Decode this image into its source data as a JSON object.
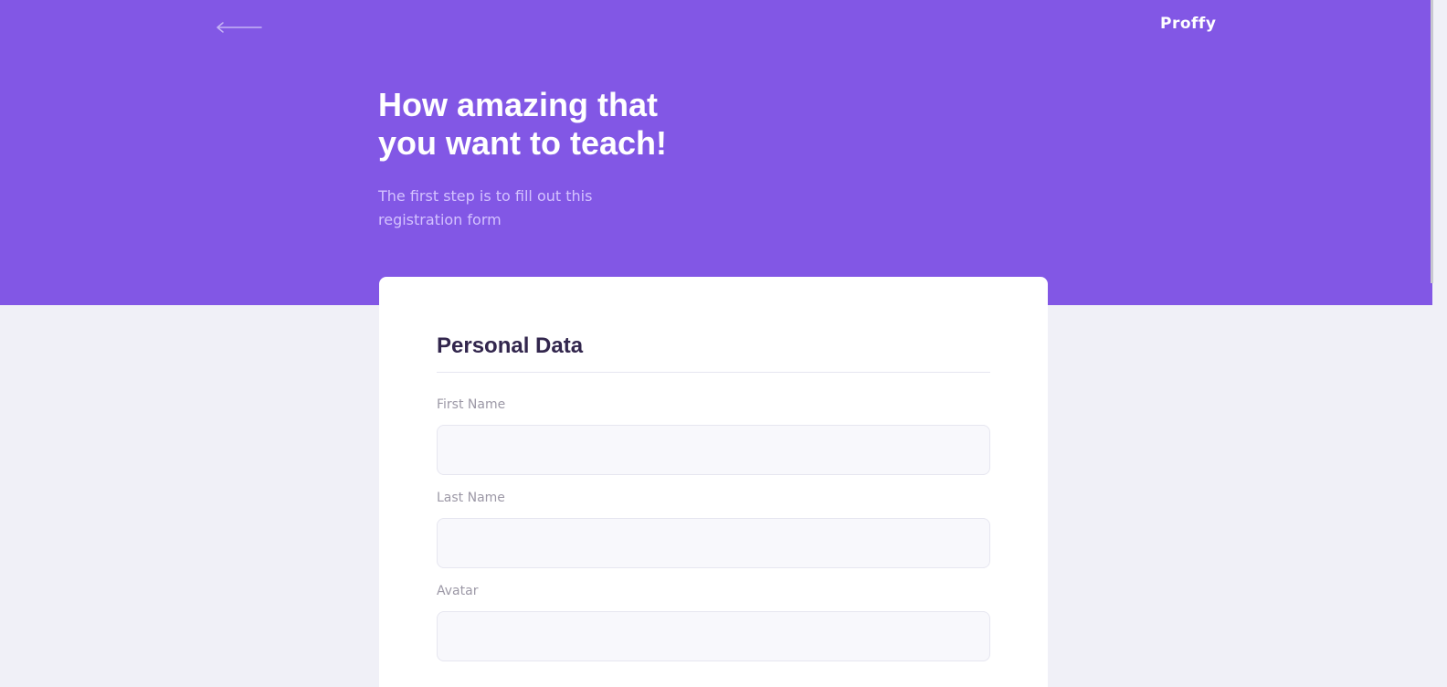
{
  "header": {
    "back_icon": "arrow-left-icon",
    "logo": "Proffy",
    "title": "How amazing that you want to teach!",
    "subtitle": "The first step is to fill out this registration form"
  },
  "form": {
    "section_title": "Personal Data",
    "fields": [
      {
        "label": "First Name",
        "value": "",
        "placeholder": ""
      },
      {
        "label": "Last Name",
        "value": "",
        "placeholder": ""
      },
      {
        "label": "Avatar",
        "value": "",
        "placeholder": ""
      }
    ]
  },
  "colors": {
    "primary": "#8257E5",
    "background": "#F0F0F7",
    "card": "#FFFFFF",
    "title_text": "#32264D",
    "subtitle_text": "#D4C2FF",
    "label_text": "#9C98A6",
    "input_bg": "#F8F8FC",
    "input_border": "#E6E6F0"
  }
}
